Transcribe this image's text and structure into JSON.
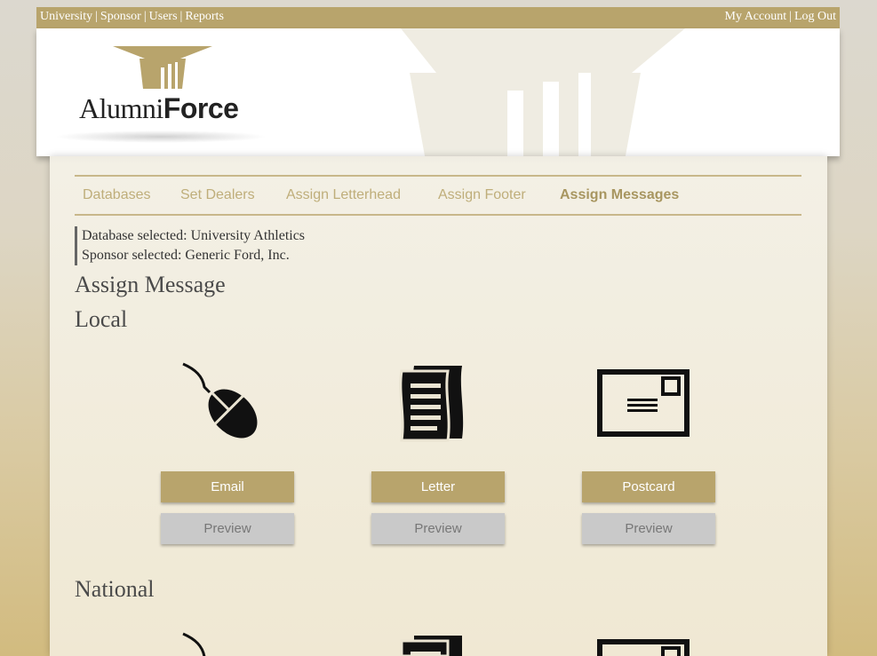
{
  "topbar": {
    "left_links": [
      "University",
      "Sponsor",
      "Users",
      "Reports"
    ],
    "right_links": [
      "My Account",
      "Log Out"
    ],
    "separator": "|"
  },
  "logo": {
    "part1": "Alumni",
    "part2": "Force"
  },
  "nav": {
    "items": [
      "Databases",
      "Set Dealers",
      "Assign Letterhead",
      "Assign Footer",
      "Assign Messages"
    ],
    "active": "Assign Messages"
  },
  "info": {
    "database": "Database selected: University Athletics",
    "sponsor": "Sponsor selected: Generic Ford, Inc."
  },
  "page_title": "Assign Message",
  "sections": {
    "local": "Local",
    "national": "National"
  },
  "cards": [
    {
      "icon": "mouse-icon",
      "action": "Email",
      "preview": "Preview"
    },
    {
      "icon": "letter-icon",
      "action": "Letter",
      "preview": "Preview"
    },
    {
      "icon": "postcard-icon",
      "action": "Postcard",
      "preview": "Preview"
    }
  ],
  "colors": {
    "accent": "#b8a46c",
    "nav_text": "#bfae7a",
    "preview_button": "#c9c9c9"
  }
}
